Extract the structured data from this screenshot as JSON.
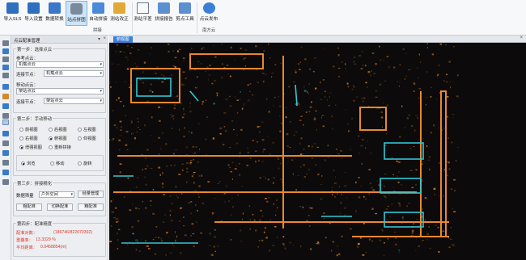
{
  "ribbon": {
    "buttons": [
      {
        "label": "导入SLS",
        "icon": "import-sls-icon"
      },
      {
        "label": "导入设置",
        "icon": "import-settings-icon"
      },
      {
        "label": "数据转换",
        "icon": "data-convert-icon"
      },
      {
        "label": "站点拼图",
        "icon": "station-stitch-icon"
      },
      {
        "label": "自动拼接",
        "icon": "auto-stitch-icon"
      },
      {
        "label": "测站改正",
        "icon": "station-correct-icon"
      },
      {
        "label": "测站平差",
        "icon": "station-adjust-icon"
      },
      {
        "label": "拼接报告",
        "icon": "stitch-report-icon"
      },
      {
        "label": "剪点工具",
        "icon": "clip-tool-icon"
      },
      {
        "label": "点云发布",
        "icon": "cloud-publish-icon"
      }
    ],
    "groups": {
      "stitch": "拼接",
      "cloud": "南方云"
    }
  },
  "panel": {
    "title": "点云配准管理",
    "step1": {
      "title": "第一步：选择点云",
      "ref_label": "参考点云：",
      "ref_value": "机载点云",
      "ref_node_label": "连接节点：",
      "ref_node_value": "机载点云",
      "move_label": "移动点云：",
      "move_value": "架站点云",
      "move_node_label": "连接节点：",
      "move_node_value": "架站点云"
    },
    "step2": {
      "title": "第二步：手动移动",
      "views": [
        {
          "label": "前视图",
          "on": false
        },
        {
          "label": "后视图",
          "on": false
        },
        {
          "label": "左视图",
          "on": false
        },
        {
          "label": "右视图",
          "on": false
        },
        {
          "label": "俯视图",
          "on": true
        },
        {
          "label": "仰视图",
          "on": false
        }
      ],
      "options": [
        {
          "label": "增强视图",
          "on": true
        },
        {
          "label": "重新拼接",
          "on": false
        }
      ],
      "modes": [
        {
          "label": "浏览",
          "on": true
        },
        {
          "label": "移动",
          "on": false
        },
        {
          "label": "旋转",
          "on": false
        }
      ]
    },
    "step3": {
      "title": "第三步：拼接精化",
      "data_label": "数据筛量",
      "data_value": "户外空间",
      "manage_button": "经量管理",
      "buttons": [
        "粗配准",
        "切换配准",
        "精配准"
      ]
    },
    "step4": {
      "title": "第四步：配准精度",
      "rows": [
        {
          "label": "配准对数：",
          "value": "(186746/822670392)"
        },
        {
          "label": "重叠率：",
          "value": "13.3329 %"
        },
        {
          "label": "平均距离：",
          "value": "0.0458854(m)"
        }
      ]
    }
  },
  "viewport": {
    "tab": "俯视图"
  },
  "colors": {
    "accent": "#3c7fd6",
    "orange": "#e9892c",
    "cyan": "#32c7d6",
    "error_text": "#d63a2f"
  }
}
